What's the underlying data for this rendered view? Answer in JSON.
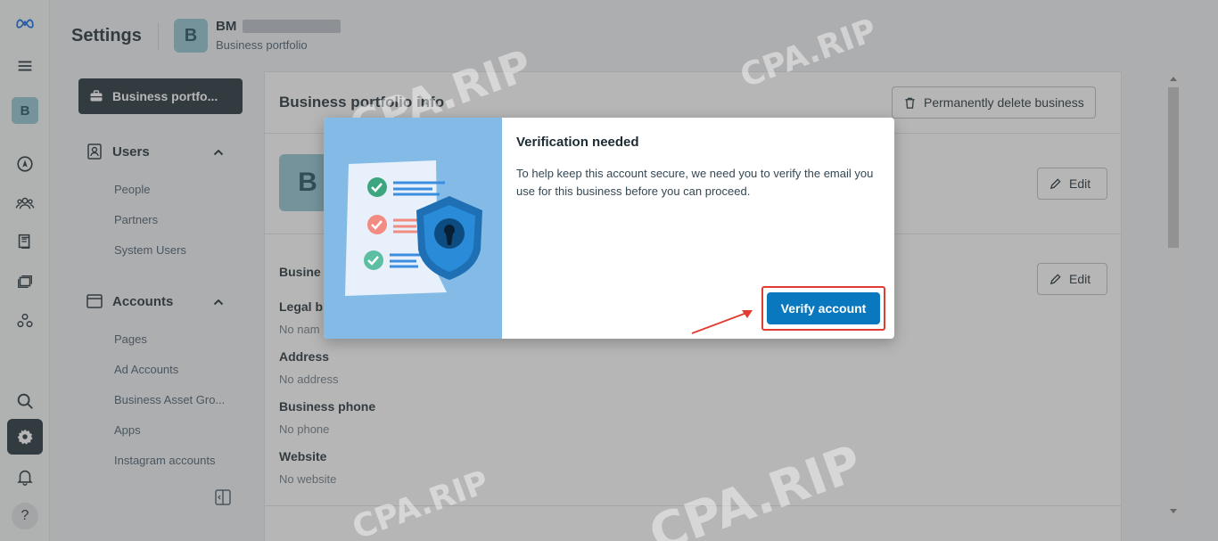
{
  "rail": {
    "business_initial": "B",
    "help_label": "?"
  },
  "header": {
    "title": "Settings",
    "avatar_initial": "B",
    "bm_name": "BM",
    "bm_subtitle": "Business portfolio"
  },
  "nav": {
    "active_label": "Business portfo...",
    "users_section": "Users",
    "users_items": [
      "People",
      "Partners",
      "System Users"
    ],
    "accounts_section": "Accounts",
    "accounts_items": [
      "Pages",
      "Ad Accounts",
      "Business Asset Gro...",
      "Apps",
      "Instagram accounts"
    ]
  },
  "main": {
    "title": "Business portfolio info",
    "delete_button": "Permanently delete business",
    "avatar_initial": "B",
    "edit_label": "Edit",
    "section_partial": "Busine",
    "legal_label_partial": "Legal b",
    "legal_value_partial": "No nam",
    "address_label": "Address",
    "address_value": "No address",
    "phone_label": "Business phone",
    "phone_value": "No phone",
    "website_label": "Website",
    "website_value": "No website"
  },
  "modal": {
    "title": "Verification needed",
    "body": "To help keep this account secure, we need you to verify the email you use for this business before you can proceed.",
    "verify_button": "Verify account"
  },
  "watermark": {
    "text": "CPA.RIP"
  },
  "colors": {
    "primary_button": "#0a78be",
    "nav_active_bg": "#1c2b33",
    "highlight": "#e03c31",
    "avatar_bg": "#8fc3d1"
  }
}
